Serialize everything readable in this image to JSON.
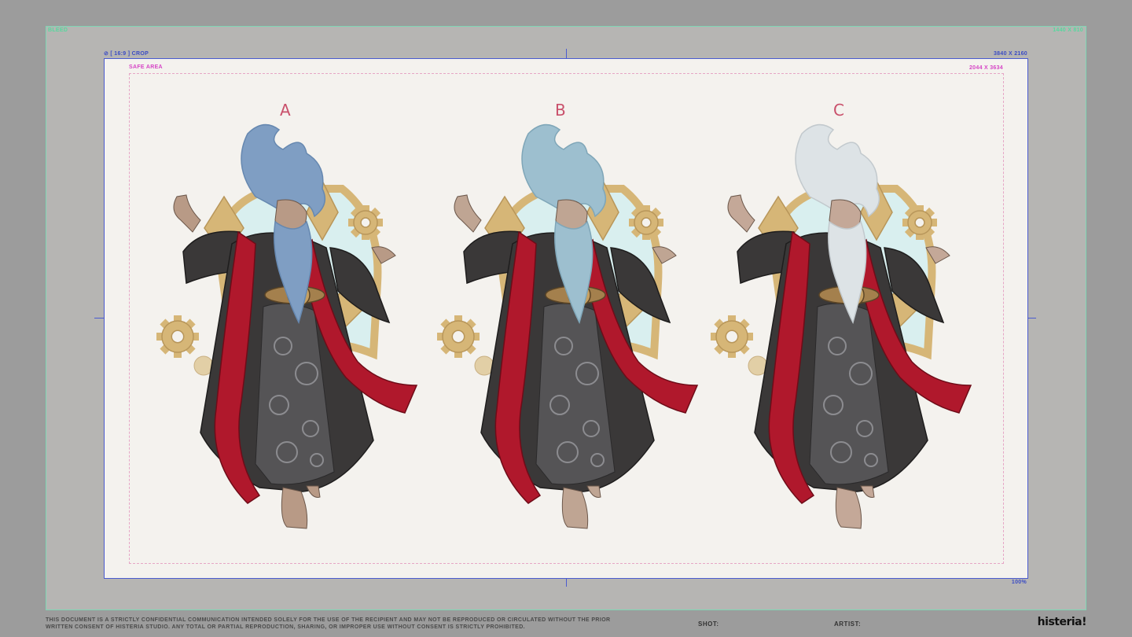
{
  "bleed": {
    "label_left": "BLEED",
    "label_right": "1440 X 810"
  },
  "crop": {
    "label_left": "⊘ [ 16:9 ] CROP",
    "label_right": "3840 X 2160",
    "zoom": "100%"
  },
  "safe_area": {
    "label_left": "SAFE AREA",
    "label_right": "2044 X 3634"
  },
  "variants": [
    {
      "letter": "A",
      "hair": "#7f9ec3",
      "hair_shade": "#6688b0",
      "skin": "#b89a86"
    },
    {
      "letter": "B",
      "hair": "#9dbfcf",
      "hair_shade": "#7fa6b8",
      "skin": "#bfa593"
    },
    {
      "letter": "C",
      "hair": "#dde3e6",
      "hair_shade": "#c2c9cd",
      "skin": "#c4a898"
    }
  ],
  "colors": {
    "robe": "#3a3838",
    "robe_inner": "#555456",
    "scarf": "#b0182c",
    "gold": "#d6b677",
    "portal": "#d9efef"
  },
  "footer": {
    "legal": "THIS DOCUMENT IS A STRICTLY CONFIDENTIAL COMMUNICATION INTENDED SOLELY FOR THE USE OF THE RECIPIENT AND MAY NOT BE REPRODUCED OR CIRCULATED WITHOUT THE PRIOR WRITTEN CONSENT OF HISTERIA STUDIO. ANY TOTAL OR PARTIAL REPRODUCTION, SHARING, OR IMPROPER USE WITHOUT CONSENT IS STRICTLY PROHIBITED.",
    "shot_label": "SHOT:",
    "artist_label": "ARTIST:",
    "brand": "histeria!"
  }
}
